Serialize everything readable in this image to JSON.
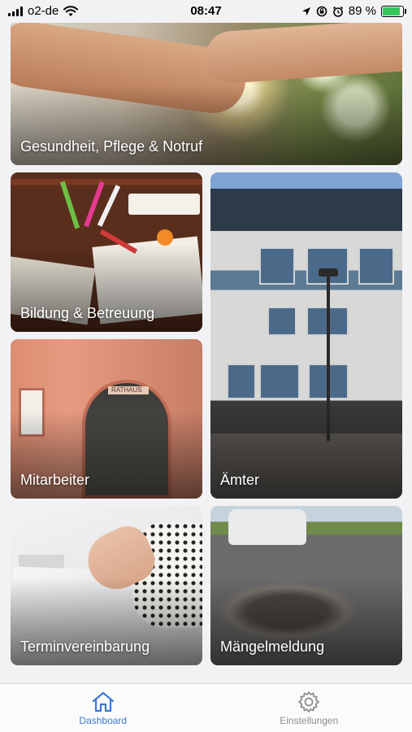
{
  "status_bar": {
    "carrier": "o2-de",
    "time": "08:47",
    "battery_percent": "89 %",
    "battery_level": 0.89,
    "battery_color": "#35c759",
    "icons": [
      "signal-icon",
      "wifi-icon",
      "location-icon",
      "lock-rotation-icon",
      "alarm-icon",
      "battery-charging-icon"
    ]
  },
  "tiles": [
    {
      "id": "health",
      "label": "Gesundheit, Pflege & Notruf"
    },
    {
      "id": "education",
      "label": "Bildung & Betreuung"
    },
    {
      "id": "offices",
      "label": "Ämter"
    },
    {
      "id": "staff",
      "label": "Mitarbeiter"
    },
    {
      "id": "appointments",
      "label": "Terminvereinbarung"
    },
    {
      "id": "defects",
      "label": "Mängelmeldung"
    }
  ],
  "image_signs": {
    "town_hall": "RATHAUS"
  },
  "tab_bar": {
    "accent_color": "#3a79d4",
    "inactive_color": "#8e8e93",
    "tabs": [
      {
        "label": "Dashboard",
        "icon": "home-icon",
        "active": true
      },
      {
        "label": "Einstellungen",
        "icon": "gear-icon",
        "active": false
      }
    ]
  }
}
